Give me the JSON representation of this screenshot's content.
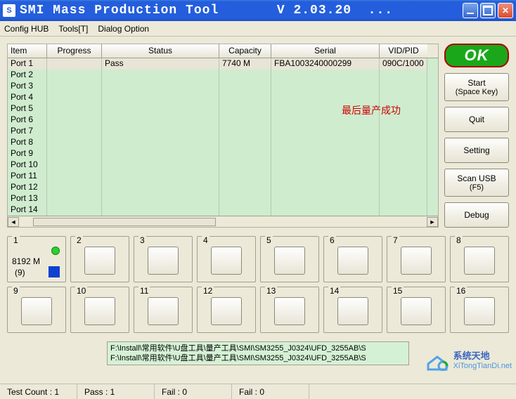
{
  "title": "SMI Mass Production Tool       V 2.03.20  ...",
  "menu": {
    "m1": "Config HUB",
    "m2": "Tools[T]",
    "m3": "Dialog Option"
  },
  "table": {
    "headers": {
      "item": "Item",
      "progress": "Progress",
      "status": "Status",
      "capacity": "Capacity",
      "serial": "Serial",
      "vidpid": "VID/PID"
    },
    "row1": {
      "item": "Port 1",
      "progress": "",
      "status": "Pass",
      "capacity": "7740 M",
      "serial": "FBA1003240000299",
      "vidpid": "090C/1000"
    },
    "ports": [
      "Port 2",
      "Port 3",
      "Port 4",
      "Port 5",
      "Port 6",
      "Port 7",
      "Port 8",
      "Port 9",
      "Port 10",
      "Port 11",
      "Port 12",
      "Port 13",
      "Port 14"
    ]
  },
  "annotation": "最后量产成功",
  "ok_label": "OK",
  "buttons": {
    "start": {
      "line1": "Start",
      "line2": "(Space Key)"
    },
    "quit": "Quit",
    "setting": "Setting",
    "scan": {
      "line1": "Scan USB",
      "line2": "(F5)"
    },
    "debug": "Debug"
  },
  "slots": {
    "labels": [
      "1",
      "2",
      "3",
      "4",
      "5",
      "6",
      "7",
      "8",
      "9",
      "10",
      "11",
      "12",
      "13",
      "14",
      "15",
      "16"
    ],
    "active": {
      "cap": "8192 M",
      "idx": "(9)"
    }
  },
  "paths": {
    "p1": "F:\\Install\\常用软件\\U盘工具\\量产工具\\SMI\\SM3255_J0324\\UFD_3255AB\\S",
    "p2": "F:\\Install\\常用软件\\U盘工具\\量产工具\\SMI\\SM3255_J0324\\UFD_3255AB\\S"
  },
  "status": {
    "test": "Test Count : 1",
    "pass": "Pass : 1",
    "fail1": "Fail : 0",
    "fail2": "Fail : 0"
  },
  "watermark": {
    "top": "系统天地",
    "bot": "XiTongTianDi.net"
  }
}
